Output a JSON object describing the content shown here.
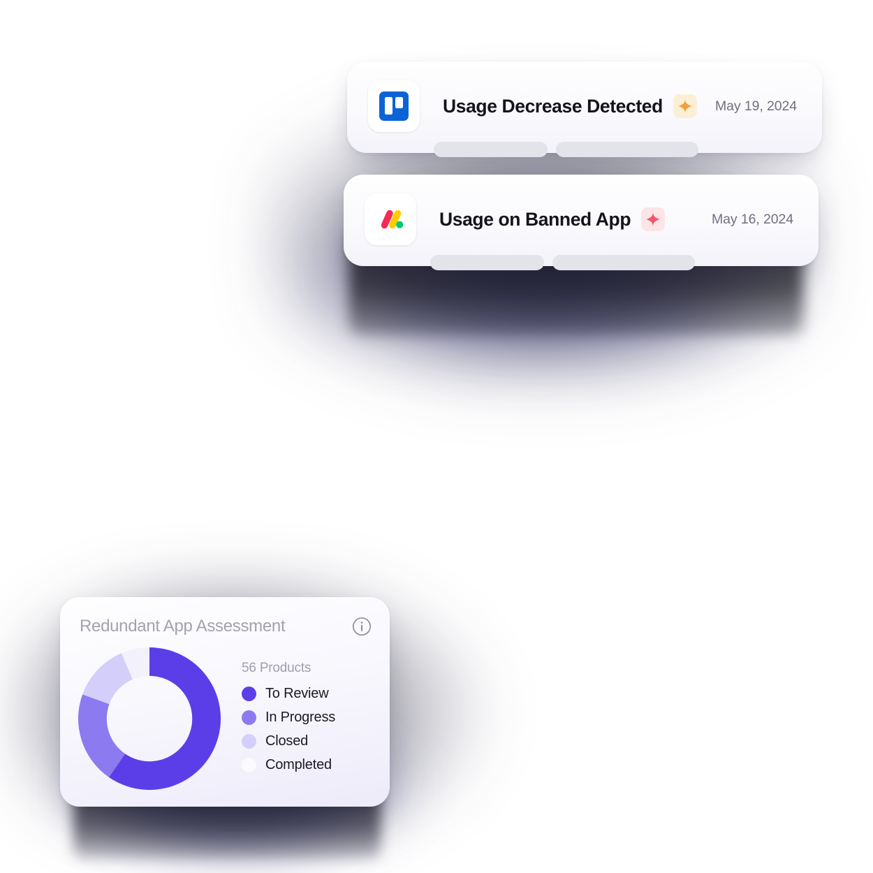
{
  "notifications": [
    {
      "app_icon": "trello-icon",
      "title": "Usage Decrease Detected",
      "badge_icon": "sparkle-icon",
      "badge_tone": "amber",
      "date": "May 19, 2024",
      "skeleton_bars": 2
    },
    {
      "app_icon": "monday-icon",
      "title": "Usage on Banned App",
      "badge_icon": "sparkle-icon",
      "badge_tone": "rose",
      "date": "May 16, 2024",
      "skeleton_bars": 2
    }
  ],
  "chart_card": {
    "title": "Redundant App Assessment",
    "info_icon": "info-circle-icon",
    "total_label": "56 Products"
  },
  "chart_data": {
    "type": "pie",
    "title": "Redundant App Assessment",
    "total": 56,
    "total_label": "56 Products",
    "legend_position": "right",
    "categories": [
      "To Review",
      "In Progress",
      "Closed",
      "Completed"
    ],
    "values": [
      33.4,
      11.7,
      7.3,
      3.6
    ],
    "percentages": [
      59.7,
      20.8,
      13.1,
      6.4
    ],
    "colors": [
      "#5B3EE8",
      "#8B7AF0",
      "#D3CFFA",
      "#F2F1FC"
    ],
    "start_angle": 0,
    "direction": "clockwise",
    "inner_radius_ratio": 0.6
  },
  "colors": {
    "accent_purple": "#5B3EE8",
    "accent_purple_mid": "#8B7AF0",
    "accent_purple_light": "#D3CFFA",
    "accent_purple_pale": "#F2F1FC",
    "amber_badge_bg": "#FDEFD6",
    "amber_badge_fg": "#F0A33C",
    "rose_badge_bg": "#FDE4E6",
    "rose_badge_fg": "#F2566B",
    "trello_blue": "#0B63D6",
    "monday_red": "#F62B54",
    "monday_yellow": "#FFCB00",
    "monday_green": "#00CA72",
    "card_bg": "#FAFAFD",
    "title_text": "#14141C",
    "muted_text": "#6F6F80",
    "skeleton": "#E3E3EA"
  }
}
